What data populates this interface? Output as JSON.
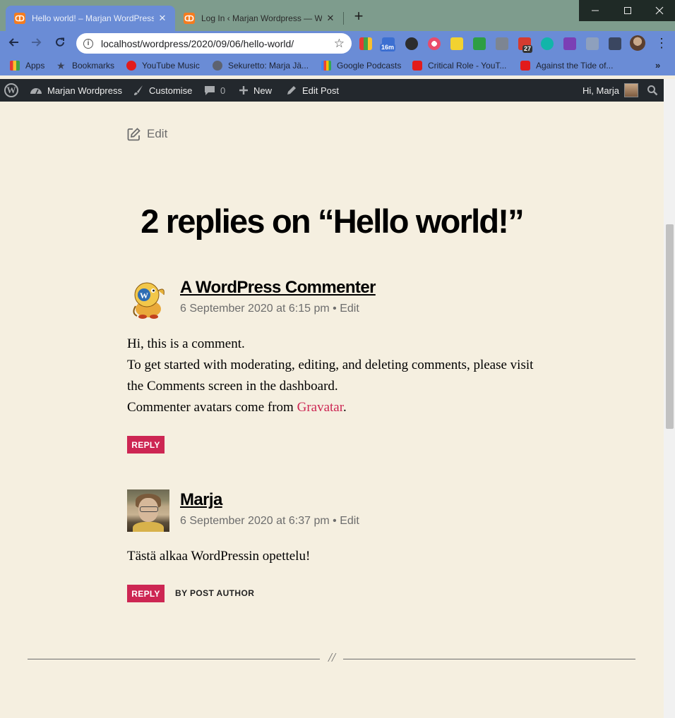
{
  "browser": {
    "tabs": [
      {
        "title": "Hello world! – Marjan WordPress",
        "favicon": "xampp-icon",
        "active": true
      },
      {
        "title": "Log In ‹ Marjan Wordpress — WordPress",
        "favicon": "xampp-icon",
        "active": false
      }
    ],
    "new_tab_label": "+",
    "url": "localhost/wordpress/2020/09/06/hello-world/",
    "extension_badges": {
      "timer": "16m",
      "todoist": "27"
    },
    "bookmarks": [
      {
        "label": "Apps",
        "icon": "apps-grid-icon"
      },
      {
        "label": "Bookmarks",
        "icon": "star-icon"
      },
      {
        "label": "YouTube Music",
        "icon": "youtube-music-icon"
      },
      {
        "label": "Sekuretto: Marja Jä...",
        "icon": "globe-icon"
      },
      {
        "label": "Google Podcasts",
        "icon": "google-podcasts-icon"
      },
      {
        "label": "Critical Role - YouT...",
        "icon": "youtube-icon"
      },
      {
        "label": "Against the Tide of...",
        "icon": "youtube-icon"
      }
    ],
    "bookmarks_more": "»"
  },
  "admin_bar": {
    "site_name": "Marjan Wordpress",
    "customise": "Customise",
    "comments_count": "0",
    "new": "New",
    "edit_post": "Edit Post",
    "greeting": "Hi, Marja"
  },
  "post": {
    "edit_label": "Edit"
  },
  "comments": {
    "title": "2 replies on “Hello world!”",
    "items": [
      {
        "author": "A WordPress Commenter",
        "date": "6 September 2020 at 6:15 pm",
        "edit": "Edit",
        "paragraphs": [
          "Hi, this is a comment.",
          "To get started with moderating, editing, and deleting comments, please visit the Comments screen in the dashboard."
        ],
        "avatars_line_prefix": "Commenter avatars come from ",
        "gravatar_link": "Gravatar",
        "avatars_line_suffix": ".",
        "reply": "REPLY"
      },
      {
        "author": "Marja",
        "date": "6 September 2020 at 6:37 pm",
        "edit": "Edit",
        "paragraphs": [
          "Tästä alkaa WordPressin opettelu!"
        ],
        "reply": "REPLY",
        "badge": "BY POST AUTHOR"
      }
    ]
  },
  "separator": "//",
  "colors": {
    "page_background": "#f5efe0",
    "accent": "#cd2653",
    "admin_bar": "#23282d",
    "browser_frame": "#6a8cd6",
    "meta_text": "#6d6d6d"
  }
}
